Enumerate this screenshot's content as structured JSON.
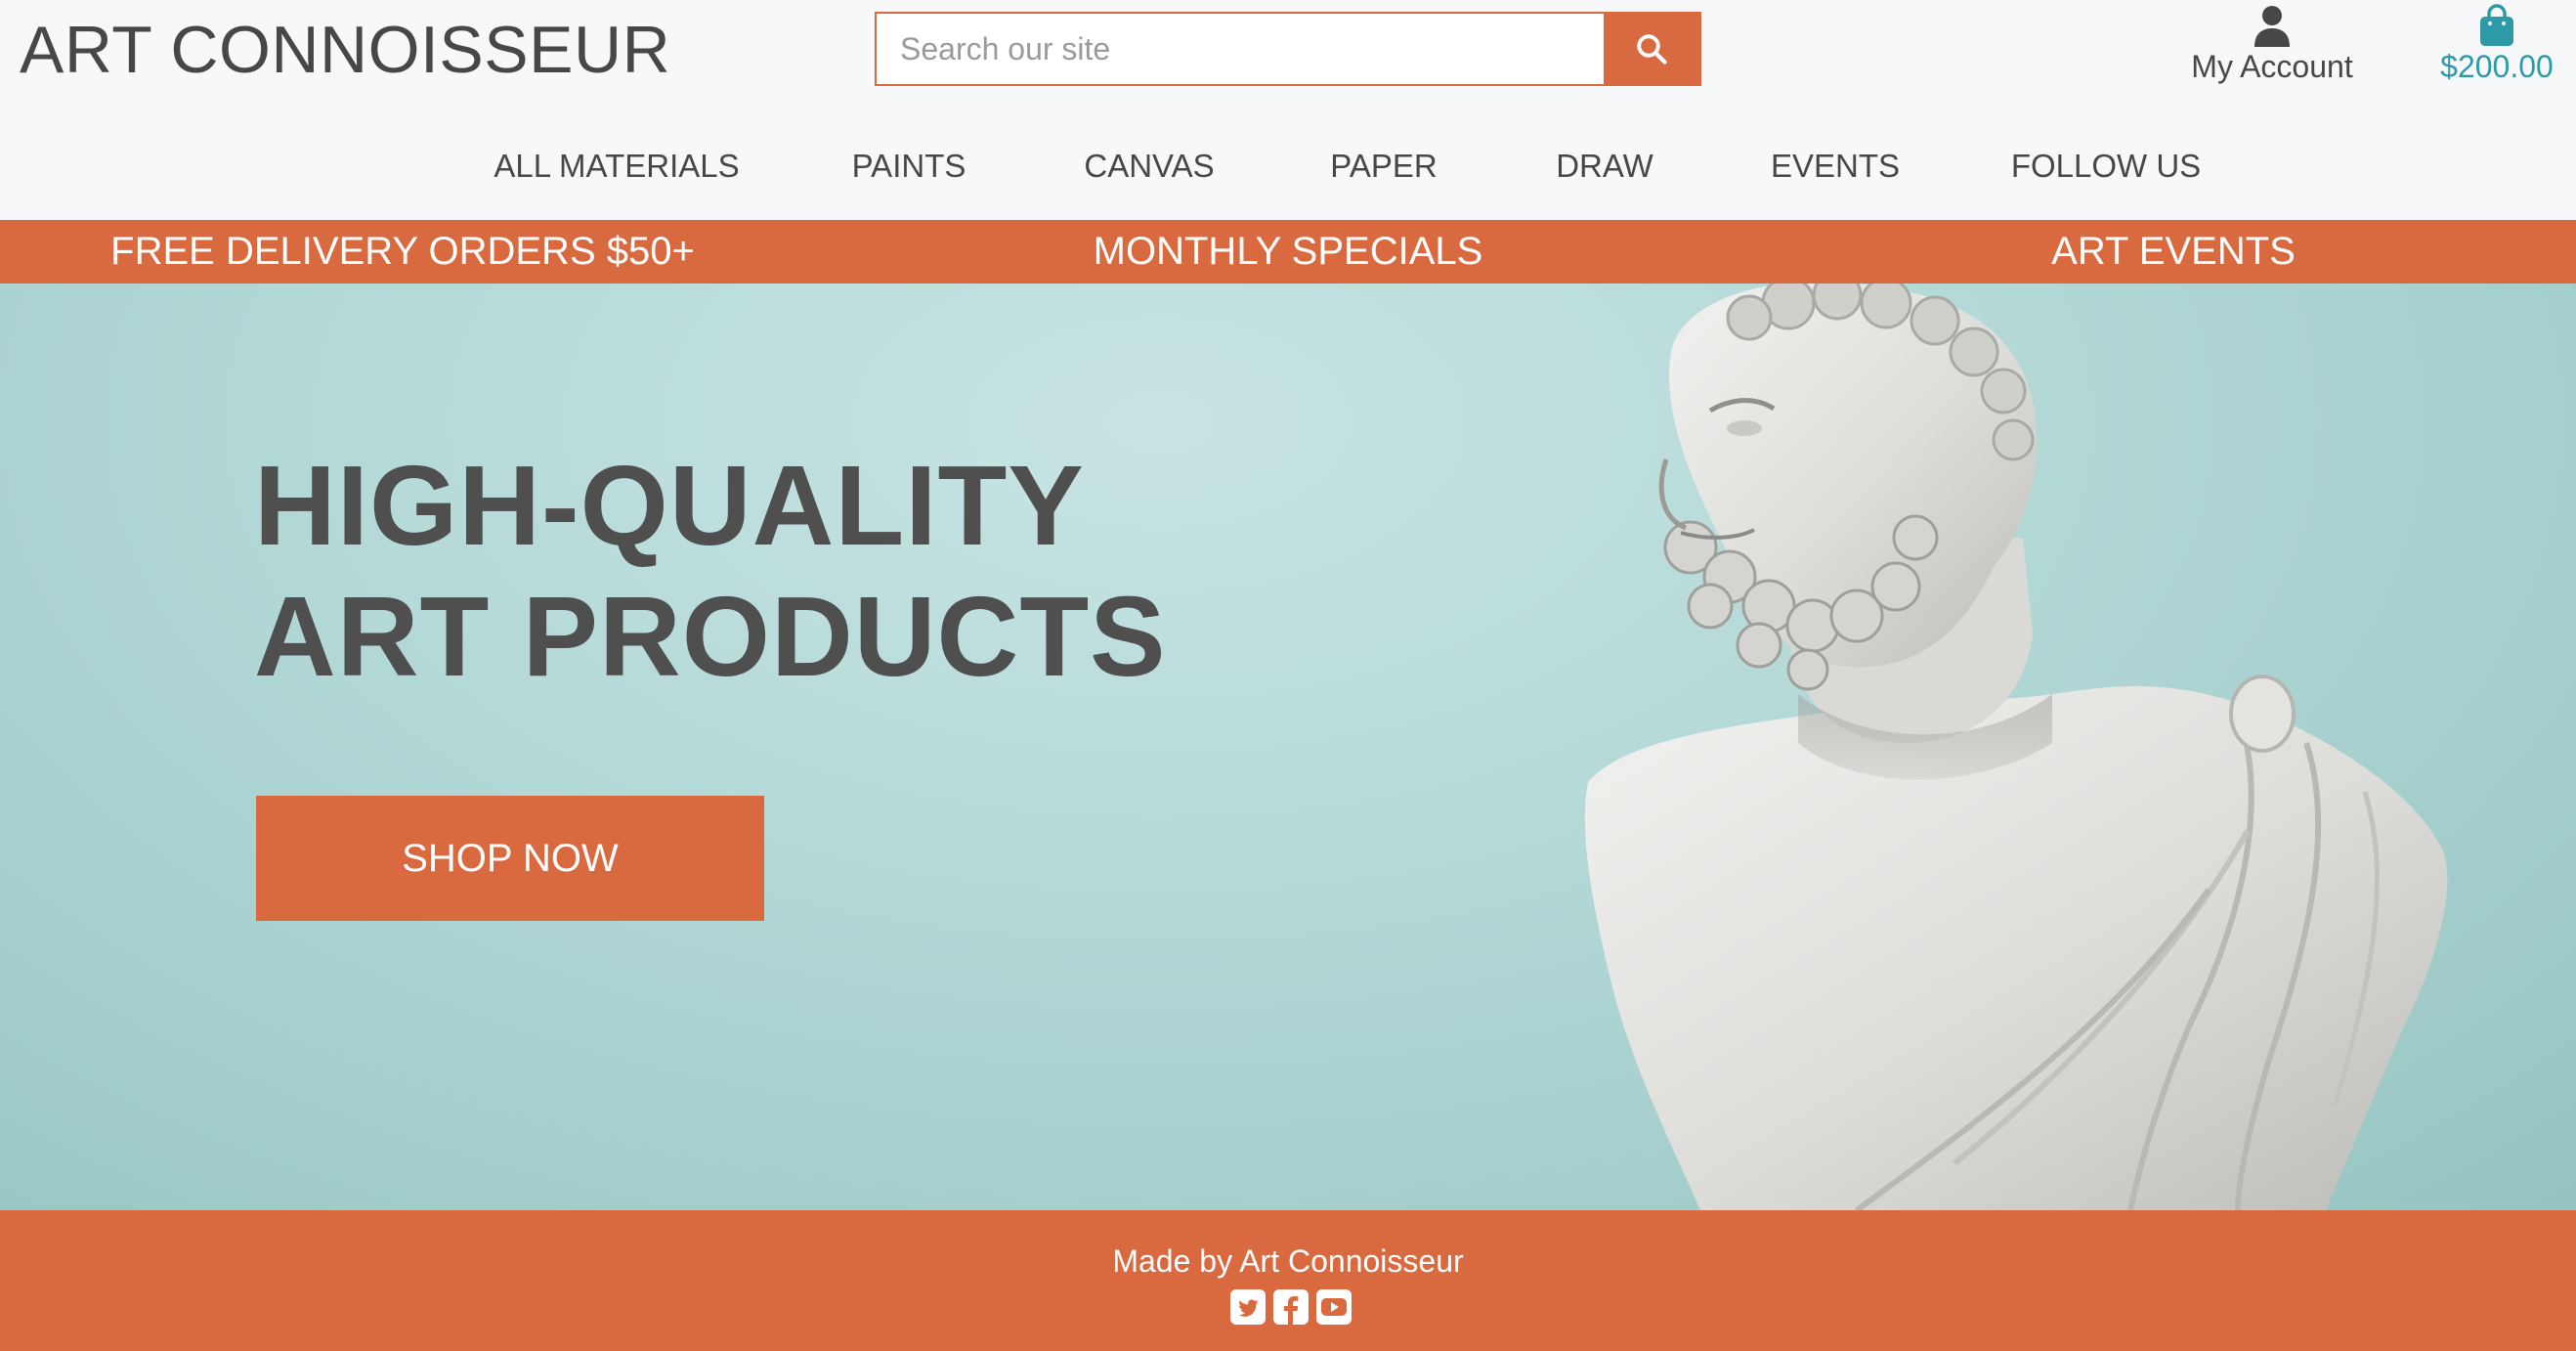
{
  "header": {
    "brand": "ART CONNOISSEUR",
    "search": {
      "placeholder": "Search our site",
      "value": ""
    },
    "account_label": "My Account",
    "cart_total": "$200.00",
    "icons": {
      "search": "search-icon",
      "account": "user-icon",
      "cart": "shopping-bag-icon"
    }
  },
  "nav": {
    "items": [
      {
        "label": "ALL MATERIALS"
      },
      {
        "label": "PAINTS"
      },
      {
        "label": "CANVAS"
      },
      {
        "label": "PAPER"
      },
      {
        "label": "DRAW"
      },
      {
        "label": "EVENTS"
      },
      {
        "label": "FOLLOW US"
      }
    ]
  },
  "promo": {
    "items": [
      {
        "label": "FREE DELIVERY ORDERS $50+"
      },
      {
        "label": "MONTHLY SPECIALS"
      },
      {
        "label": "ART EVENTS"
      }
    ]
  },
  "hero": {
    "title_line1": "HIGH-QUALITY",
    "title_line2": "ART PRODUCTS",
    "cta_label": "SHOP NOW",
    "image": "marble-bust-image"
  },
  "footer": {
    "text": "Made by Art Connoisseur",
    "social": [
      "twitter-icon",
      "facebook-icon",
      "youtube-icon"
    ]
  },
  "colors": {
    "accent": "#d9693f",
    "cart": "#2e9aa8",
    "text": "#474747",
    "hero_bg": "#b2d8d6"
  }
}
